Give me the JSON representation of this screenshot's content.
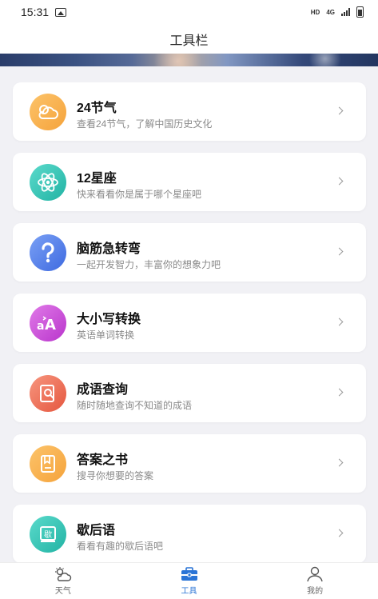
{
  "status_bar": {
    "time": "15:31",
    "hd": "HD",
    "network": "4G"
  },
  "header": {
    "title": "工具栏"
  },
  "tools": [
    {
      "title": "24节气",
      "subtitle": "查看24节气，了解中国历史文化",
      "icon": "cloud-icon",
      "color": "#f5a33b"
    },
    {
      "title": "12星座",
      "subtitle": "快来看看你是属于哪个星座吧",
      "icon": "atom-icon",
      "color": "#2fc4b4"
    },
    {
      "title": "脑筋急转弯",
      "subtitle": "一起开发智力，丰富你的想象力吧",
      "icon": "question-icon",
      "color": "#4a78e6"
    },
    {
      "title": "大小写转换",
      "subtitle": "英语单词转换",
      "icon": "letter-case-icon",
      "color": "#c548d6"
    },
    {
      "title": "成语查询",
      "subtitle": "随时随地查询不知道的成语",
      "icon": "search-doc-icon",
      "color": "#ef6a52"
    },
    {
      "title": "答案之书",
      "subtitle": "搜寻你想要的答案",
      "icon": "book-icon",
      "color": "#f5a33b"
    },
    {
      "title": "歇后语",
      "subtitle": "看看有趣的歇后语吧",
      "icon": "xie-icon",
      "icon_text": "歇",
      "color": "#2fc4b4"
    }
  ],
  "tab_bar": {
    "tabs": [
      {
        "label": "天气",
        "icon": "weather-icon",
        "active": false
      },
      {
        "label": "工具",
        "icon": "toolbox-icon",
        "active": true
      },
      {
        "label": "我的",
        "icon": "user-icon",
        "active": false
      }
    ],
    "active_color": "#2a74d6"
  }
}
